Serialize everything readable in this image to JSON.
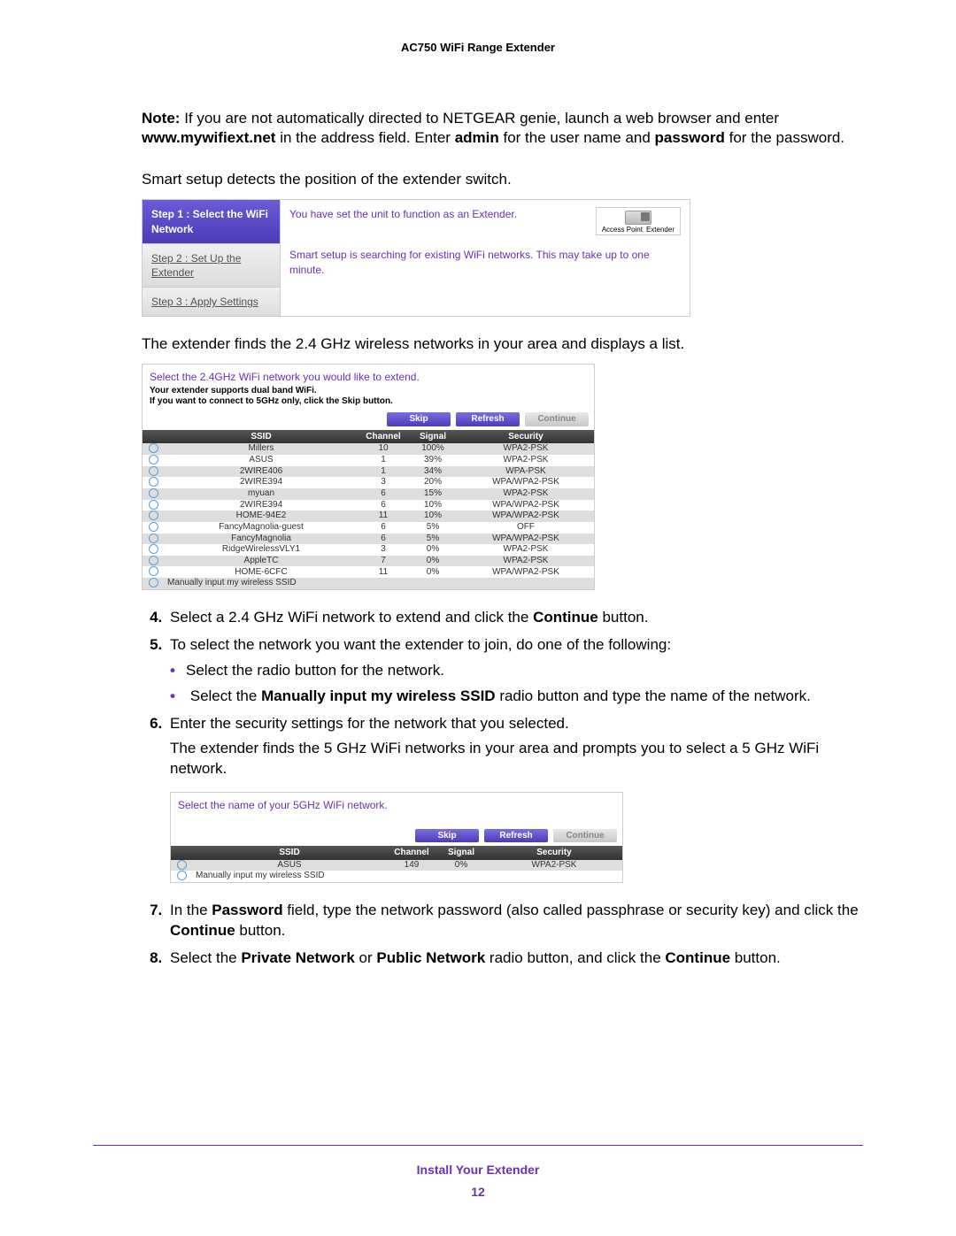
{
  "header": {
    "product": "AC750 WiFi Range Extender"
  },
  "note": {
    "label": "Note:",
    "text_parts": {
      "pre": "If you are not automatically directed to NETGEAR genie, launch a web browser and enter ",
      "url": "www.mywifiext.net",
      "mid1": " in the address field. Enter ",
      "admin": "admin",
      "mid2": " for the user name and ",
      "password": "password",
      "post": " for the password."
    }
  },
  "intro1": "Smart setup detects the position of the extender switch.",
  "fig1": {
    "steps": {
      "s1": "Step 1 : Select the WiFi Network",
      "s2": "Step 2 : Set Up the Extender",
      "s3": "Step 3 : Apply Settings"
    },
    "msg1": "You have set the unit to function as an Extender.",
    "msg2": "Smart setup is searching for existing WiFi networks. This may take up to one minute.",
    "switch": {
      "left": "Access Point",
      "right": "Extender"
    }
  },
  "intro2": "The extender finds the 2.4 GHz wireless networks in your area and displays a list.",
  "fig2": {
    "title": "Select the 2.4GHz WiFi network you would like to extend.",
    "sub1": "Your extender supports dual band WiFi.",
    "sub2": "If you want to connect to 5GHz only, click the Skip button.",
    "buttons": {
      "skip": "Skip",
      "refresh": "Refresh",
      "cont": "Continue"
    },
    "headers": {
      "ssid": "SSID",
      "ch": "Channel",
      "sig": "Signal",
      "sec": "Security"
    },
    "rows": [
      {
        "ssid": "Millers",
        "ch": "10",
        "sig": "100%",
        "sec": "WPA2-PSK"
      },
      {
        "ssid": "ASUS",
        "ch": "1",
        "sig": "39%",
        "sec": "WPA2-PSK"
      },
      {
        "ssid": "2WIRE406",
        "ch": "1",
        "sig": "34%",
        "sec": "WPA-PSK"
      },
      {
        "ssid": "2WIRE394",
        "ch": "3",
        "sig": "20%",
        "sec": "WPA/WPA2-PSK"
      },
      {
        "ssid": "myuan",
        "ch": "6",
        "sig": "15%",
        "sec": "WPA2-PSK"
      },
      {
        "ssid": "2WIRE394",
        "ch": "6",
        "sig": "10%",
        "sec": "WPA/WPA2-PSK"
      },
      {
        "ssid": "HOME-94E2",
        "ch": "11",
        "sig": "10%",
        "sec": "WPA/WPA2-PSK"
      },
      {
        "ssid": "FancyMagnolia-guest",
        "ch": "6",
        "sig": "5%",
        "sec": "OFF"
      },
      {
        "ssid": "FancyMagnolia",
        "ch": "6",
        "sig": "5%",
        "sec": "WPA/WPA2-PSK"
      },
      {
        "ssid": "RidgeWirelessVLY1",
        "ch": "3",
        "sig": "0%",
        "sec": "WPA2-PSK"
      },
      {
        "ssid": "AppleTC",
        "ch": "7",
        "sig": "0%",
        "sec": "WPA2-PSK"
      },
      {
        "ssid": "HOME-6CFC",
        "ch": "11",
        "sig": "0%",
        "sec": "WPA/WPA2-PSK"
      }
    ],
    "manual": "Manually input my wireless SSID"
  },
  "list": {
    "i4": {
      "pre": "Select a 2.4 GHz WiFi network to extend and click the ",
      "b": "Continue",
      "post": " button."
    },
    "i5": {
      "text": "To select the network you want the extender to join, do one of the following:",
      "b1": "Select the radio button for the network.",
      "b2": {
        "pre": "Select the ",
        "b": "Manually input my wireless SSID",
        "post": " radio button and type the name of the network."
      }
    },
    "i6": {
      "l1": "Enter the security settings for the network that you selected.",
      "l2": "The extender finds the 5 GHz WiFi networks in your area and prompts you to select a 5 GHz WiFi network."
    },
    "i7": {
      "pre": "In the ",
      "b1": "Password",
      "mid": " field, type the network password (also called passphrase or security key) and click the ",
      "b2": "Continue",
      "post": " button."
    },
    "i8": {
      "pre": "Select the ",
      "b1": "Private Network",
      "mid1": " or ",
      "b2": "Public Network",
      "mid2": " radio button, and click the ",
      "b3": "Continue",
      "post": " button."
    }
  },
  "fig3": {
    "title": "Select the name of your 5GHz WiFi network.",
    "buttons": {
      "skip": "Skip",
      "refresh": "Refresh",
      "cont": "Continue"
    },
    "headers": {
      "ssid": "SSID",
      "ch": "Channel",
      "sig": "Signal",
      "sec": "Security"
    },
    "rows": [
      {
        "ssid": "ASUS",
        "ch": "149",
        "sig": "0%",
        "sec": "WPA2-PSK"
      }
    ],
    "manual": "Manually input my wireless SSID"
  },
  "footer": {
    "section": "Install Your Extender",
    "page": "12"
  }
}
